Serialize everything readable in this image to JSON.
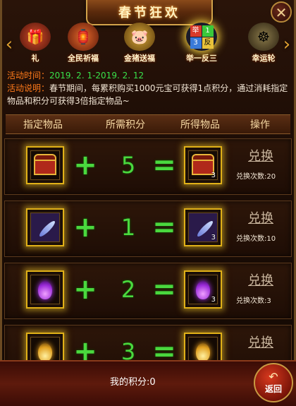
{
  "header": {
    "title": "春节狂欢",
    "close_symbol": "✕"
  },
  "tabs": [
    {
      "label": "礼",
      "icon": "gift-icon",
      "color": "#b8402a"
    },
    {
      "label": "全民祈福",
      "icon": "blessing-lantern-icon",
      "color": "#c83a20"
    },
    {
      "label": "金猪送福",
      "icon": "golden-pig-icon",
      "color": "#b88a2a"
    },
    {
      "label": "举一反三",
      "icon": "four-grid-icon",
      "color": "#e8c23a"
    },
    {
      "label": "幸运轮",
      "icon": "lucky-wheel-icon",
      "color": "#5a4a2a"
    }
  ],
  "info": {
    "time_label": "活动时间：",
    "time_value": "2019. 2. 1-2019. 2. 12",
    "desc_label": "活动说明：",
    "desc_text": "春节期间，每累积购买1000元宝可获得1点积分，通过消耗指定物品和积分可获得3倍指定物品~"
  },
  "table": {
    "headers": [
      "指定物品",
      "所需积分",
      "所得物品",
      "操作"
    ],
    "rows": [
      {
        "item": "spring-festival-chest",
        "points": "5",
        "reward_qty": "3",
        "button": "兑换",
        "count_text": "兑换次数:20"
      },
      {
        "item": "feather",
        "points": "1",
        "reward_qty": "3",
        "button": "兑换",
        "count_text": "兑换次数:10"
      },
      {
        "item": "purple-flame",
        "points": "2",
        "reward_qty": "3",
        "button": "兑换",
        "count_text": "兑换次数:3"
      },
      {
        "item": "golden-flame",
        "points": "3",
        "reward_qty": "",
        "button": "兑换",
        "count_text": ""
      }
    ],
    "plus": "+",
    "equals": "="
  },
  "footer": {
    "points_text": "我的积分:0",
    "back_label": "返回",
    "back_arrow": "↶"
  },
  "colors": {
    "accent_green": "#4ad83e",
    "label_orange": "#ff7a1a",
    "gold_border": "#e0b018"
  }
}
